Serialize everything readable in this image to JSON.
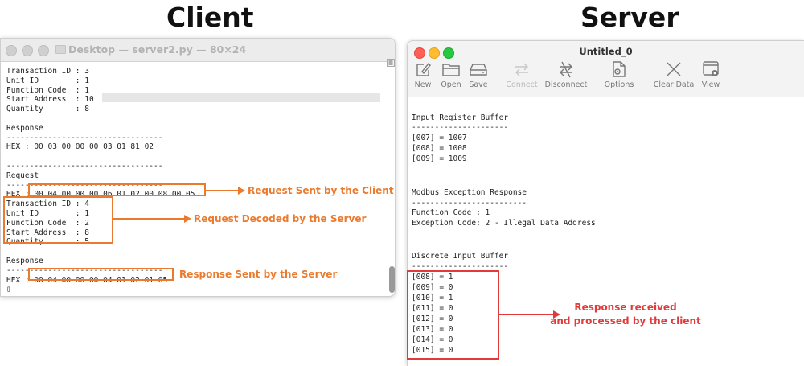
{
  "headings": {
    "client": "Client",
    "server": "Server"
  },
  "client": {
    "window_title": "Desktop — server2.py — 80×24",
    "lines": [
      "Transaction ID : 3",
      "Unit ID        : 1",
      "Function Code  : 1",
      "Start Address  : 10",
      "Quantity       : 8",
      "",
      "Response",
      "----------------------------------",
      "HEX : 00 03 00 00 00 03 01 81 02",
      "",
      "----------------------------------",
      "Request",
      "----------------------------------",
      "HEX : 00 04 00 00 00 06 01 02 00 08 00 05",
      "Transaction ID : 4",
      "Unit ID        : 1",
      "Function Code  : 2",
      "Start Address  : 8",
      "Quantity       : 5",
      "",
      "Response",
      "----------------------------------",
      "HEX : 00 04 00 00 00 04 01 02 01 05",
      "▯"
    ]
  },
  "server": {
    "window_title": "Untitled_0",
    "toolbar": [
      {
        "label": "New",
        "icon": "new-icon",
        "enabled": true
      },
      {
        "label": "Open",
        "icon": "folder-icon",
        "enabled": true
      },
      {
        "label": "Save",
        "icon": "save-icon",
        "enabled": true
      },
      {
        "label": "Connect",
        "icon": "connect-icon",
        "enabled": false
      },
      {
        "label": "Disconnect",
        "icon": "disconnect-icon",
        "enabled": true
      },
      {
        "label": "Options",
        "icon": "options-icon",
        "enabled": true
      },
      {
        "label": "Clear Data",
        "icon": "clear-icon",
        "enabled": true
      },
      {
        "label": "View",
        "icon": "view-icon",
        "enabled": true
      }
    ],
    "lines": [
      "Input Register Buffer",
      "---------------------",
      "[007] = 1007",
      "[008] = 1008",
      "[009] = 1009",
      "",
      "",
      "",
      "Modbus Exception Response",
      "-------------------------",
      "Function Code : 1",
      "Exception Code: 2 - Illegal Data Address",
      "",
      "",
      "Discrete Input Buffer",
      "---------------------",
      "[008] = 1",
      "[009] = 0",
      "[010] = 1",
      "[011] = 0",
      "[012] = 0",
      "[013] = 0",
      "[014] = 0",
      "[015] = 0"
    ]
  },
  "annotations": {
    "request_sent": "Request Sent by the Client",
    "request_decoded": "Request Decoded by the Server",
    "response_sent": "Response Sent by the Server",
    "response_received_1": "Response received",
    "response_received_2": "and processed by the client"
  },
  "colors": {
    "annotation_orange": "#ea7b2e",
    "annotation_red": "#e23a3a"
  }
}
